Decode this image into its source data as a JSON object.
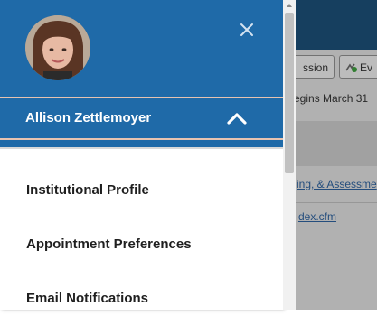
{
  "background": {
    "buttons": {
      "session_label": "ssion",
      "evaluate_label": "Ev"
    },
    "notice_text": "egins March 31",
    "links": {
      "link1": "ing, & Assessme",
      "link2": "dex.cfm"
    }
  },
  "drawer": {
    "close_icon": "close-icon",
    "user": {
      "name": "Allison Zettlemoyer",
      "toggle_icon": "chevron-up-icon"
    },
    "menu": [
      {
        "label": "Institutional Profile"
      },
      {
        "label": "Appointment Preferences"
      },
      {
        "label": "Email Notifications"
      }
    ]
  },
  "colors": {
    "drawer_header": "#1f6aa8",
    "accent_line": "#e7c3b0",
    "page_topbar": "#1b4d75"
  }
}
